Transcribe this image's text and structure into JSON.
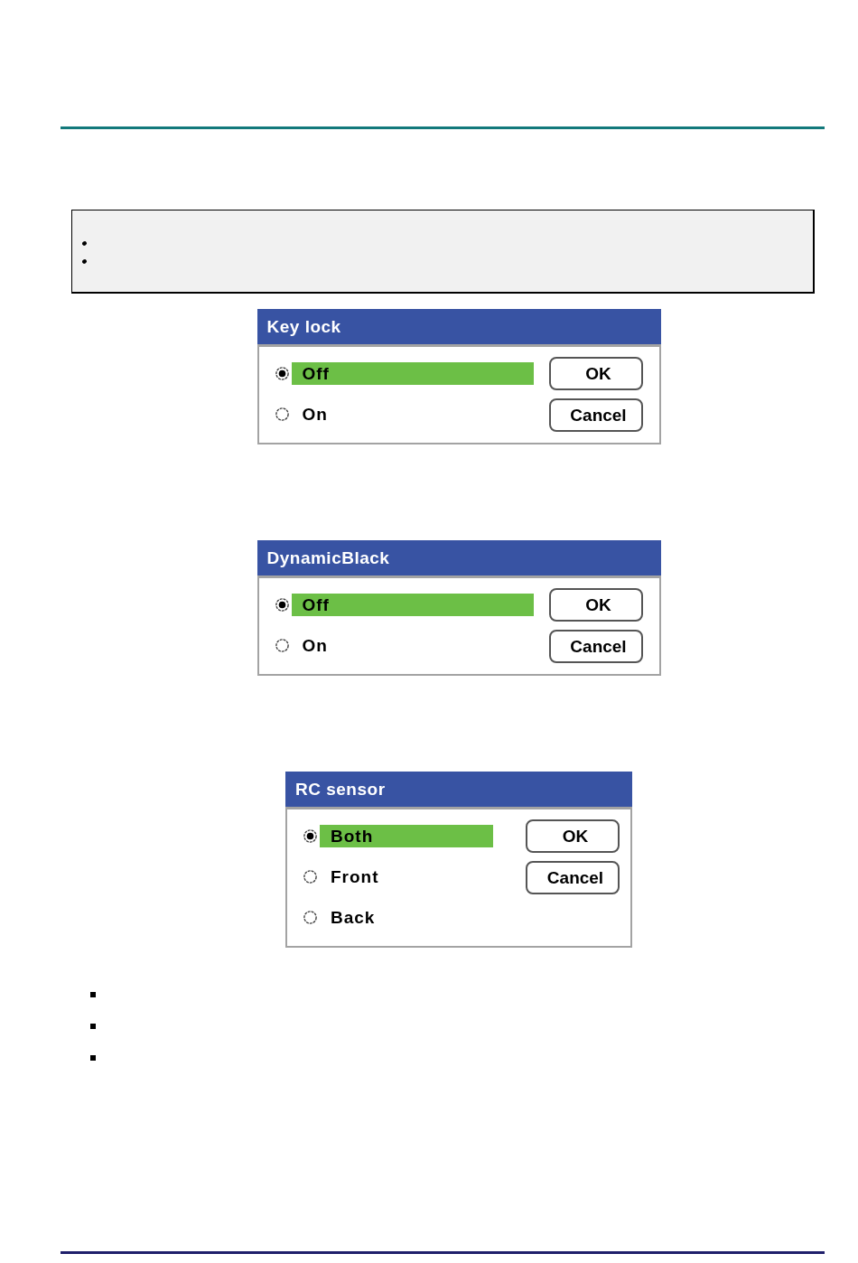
{
  "note_box": {
    "markers": [
      {
        "kind": "dot"
      },
      {
        "kind": "dot"
      }
    ]
  },
  "dialogs": [
    {
      "title": "Key lock",
      "options": [
        {
          "label": "Off",
          "selected": true
        },
        {
          "label": "On",
          "selected": false
        }
      ],
      "buttons": [
        "OK",
        "Cancel"
      ]
    },
    {
      "title": "DynamicBlack",
      "options": [
        {
          "label": "Off",
          "selected": true
        },
        {
          "label": "On",
          "selected": false
        }
      ],
      "buttons": [
        "OK",
        "Cancel"
      ]
    },
    {
      "title": "RC sensor",
      "options": [
        {
          "label": "Both",
          "selected": true
        },
        {
          "label": "Front",
          "selected": false
        },
        {
          "label": "Back",
          "selected": false
        }
      ],
      "buttons": [
        "OK",
        "Cancel"
      ]
    }
  ],
  "markers": [
    {
      "kind": "square"
    },
    {
      "kind": "square"
    },
    {
      "kind": "square"
    }
  ]
}
